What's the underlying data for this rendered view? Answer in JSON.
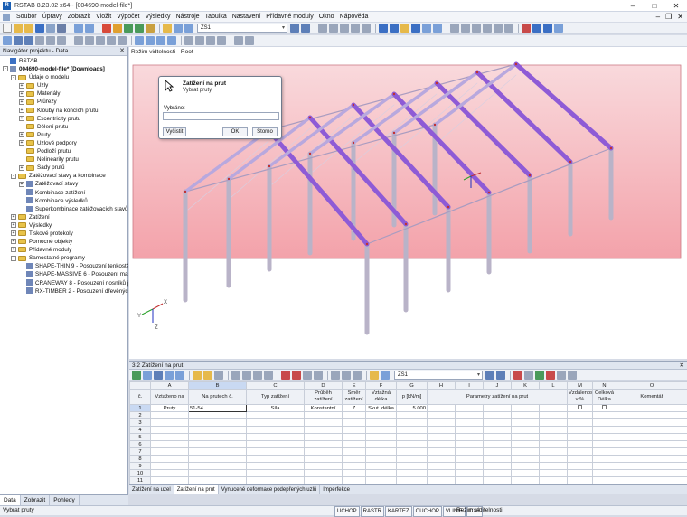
{
  "window": {
    "title": "RSTAB 8.23.02 x64 - [004690-model-file*]"
  },
  "menu": {
    "items": [
      "Soubor",
      "Úpravy",
      "Zobrazit",
      "Vložit",
      "Výpočet",
      "Výsledky",
      "Nástroje",
      "Tabulka",
      "Nastavení",
      "Přídavné moduly",
      "Okno",
      "Nápověda"
    ]
  },
  "toolbar": {
    "loadcase_combo": "ZS1"
  },
  "navigator": {
    "title": "Navigátor projektu - Data",
    "items": [
      {
        "level": 0,
        "label": "RSTAB",
        "exp": "",
        "icon": "app"
      },
      {
        "level": 0,
        "label": "004690-model-file* [Downloads]",
        "exp": "-",
        "icon": "model",
        "bold": true
      },
      {
        "level": 1,
        "label": "Údaje o modelu",
        "exp": "-",
        "icon": "folder"
      },
      {
        "level": 2,
        "label": "Uzly",
        "exp": "+",
        "icon": "folder"
      },
      {
        "level": 2,
        "label": "Materiály",
        "exp": "+",
        "icon": "folder"
      },
      {
        "level": 2,
        "label": "Průřezy",
        "exp": "+",
        "icon": "folder"
      },
      {
        "level": 2,
        "label": "Klouby na koncích prutu",
        "exp": "+",
        "icon": "folder"
      },
      {
        "level": 2,
        "label": "Excentricity prutu",
        "exp": "+",
        "icon": "folder"
      },
      {
        "level": 2,
        "label": "Dělení prutu",
        "exp": "",
        "icon": "folder"
      },
      {
        "level": 2,
        "label": "Pruty",
        "exp": "+",
        "icon": "folder"
      },
      {
        "level": 2,
        "label": "Uzlové podpory",
        "exp": "+",
        "icon": "folder"
      },
      {
        "level": 2,
        "label": "Podloží prutu",
        "exp": "",
        "icon": "folder"
      },
      {
        "level": 2,
        "label": "Nelinearity prutu",
        "exp": "",
        "icon": "folder"
      },
      {
        "level": 2,
        "label": "Sady prutů",
        "exp": "+",
        "icon": "folder"
      },
      {
        "level": 1,
        "label": "Zatěžovací stavy a kombinace",
        "exp": "-",
        "icon": "folder"
      },
      {
        "level": 2,
        "label": "Zatěžovací stavy",
        "exp": "+",
        "icon": "item"
      },
      {
        "level": 2,
        "label": "Kombinace zatížení",
        "exp": "",
        "icon": "item"
      },
      {
        "level": 2,
        "label": "Kombinace výsledků",
        "exp": "",
        "icon": "item"
      },
      {
        "level": 2,
        "label": "Superkombinace zatěžovacích stavů",
        "exp": "",
        "icon": "item"
      },
      {
        "level": 1,
        "label": "Zatížení",
        "exp": "+",
        "icon": "folder"
      },
      {
        "level": 1,
        "label": "Výsledky",
        "exp": "+",
        "icon": "folder"
      },
      {
        "level": 1,
        "label": "Tiskové protokoly",
        "exp": "+",
        "icon": "folder"
      },
      {
        "level": 1,
        "label": "Pomocné objekty",
        "exp": "+",
        "icon": "folder"
      },
      {
        "level": 1,
        "label": "Přídavné moduly",
        "exp": "+",
        "icon": "folder"
      },
      {
        "level": 1,
        "label": "Samostatné programy",
        "exp": "-",
        "icon": "folder"
      },
      {
        "level": 2,
        "label": "SHAPE-THIN 9 - Posouzení tenkostěn",
        "exp": "",
        "icon": "item"
      },
      {
        "level": 2,
        "label": "SHAPE-MASSIVE 6 - Posouzení masiv",
        "exp": "",
        "icon": "item"
      },
      {
        "level": 2,
        "label": "CRANEWAY 8 - Posouzení nosníků je",
        "exp": "",
        "icon": "item"
      },
      {
        "level": 2,
        "label": "RX-TIMBER 2 - Posouzení dřevěných",
        "exp": "",
        "icon": "item"
      }
    ],
    "tabs": [
      "Data",
      "Zobrazit",
      "Pohledy"
    ]
  },
  "viewport": {
    "title": "Režim vidtelnosti - Root",
    "axis_labels": {
      "x": "X",
      "y": "Y",
      "z": "Z"
    }
  },
  "dialog": {
    "title": "Zatížení na prut",
    "subtitle": "Vybrat pruty",
    "field_label": "Vybráno:",
    "field_value": "",
    "buttons": {
      "all": "Vyčistit",
      "ok": "OK",
      "cancel": "Storno"
    }
  },
  "table": {
    "title": "3.2 Zatížení na prut",
    "combo": "ZS1",
    "col_letters": [
      "A",
      "B",
      "C",
      "D",
      "E",
      "F",
      "G",
      "H",
      "I",
      "J",
      "K",
      "L",
      "M",
      "N",
      "O"
    ],
    "headers": {
      "rownum": "č.",
      "a": "Vztaženo na",
      "b": "Na prutech č.",
      "c": "Typ zatížení",
      "d": "Průběh zatížení",
      "e": "Směr zatížení",
      "f": "Vztažná délka",
      "g": "p [kN/m]",
      "params": "Parametry zatížení na prut",
      "m": "Vzdálenost v %",
      "n": "Celková Délka",
      "o": "Komentář"
    },
    "rows": [
      {
        "n": "1",
        "a": "Pruty",
        "b": "51-54",
        "c": "Síla",
        "d": "Konstantní",
        "e": "Z",
        "f": "Skut. délka",
        "g": "5.000"
      },
      {
        "n": "2"
      },
      {
        "n": "3"
      },
      {
        "n": "4"
      },
      {
        "n": "5"
      },
      {
        "n": "6"
      },
      {
        "n": "7"
      },
      {
        "n": "8"
      },
      {
        "n": "9"
      },
      {
        "n": "10"
      },
      {
        "n": "11"
      }
    ],
    "tabs": [
      "Zatížení na uzel",
      "Zatížení na prut",
      "Vynucené deformace podepřených uzlů",
      "Imperfekce"
    ]
  },
  "status": {
    "left": "Vybrat pruty",
    "items": [
      "UCHOP",
      "RASTR",
      "KARTEZ",
      "OUCHOP",
      "VLINIE",
      "DXF"
    ],
    "tail": "Režim viditelnosti"
  },
  "colors": {
    "bar_purple": "#8e5bd6",
    "column_grey": "#b9b3c8",
    "viewport_pink": "#f4aab0"
  }
}
